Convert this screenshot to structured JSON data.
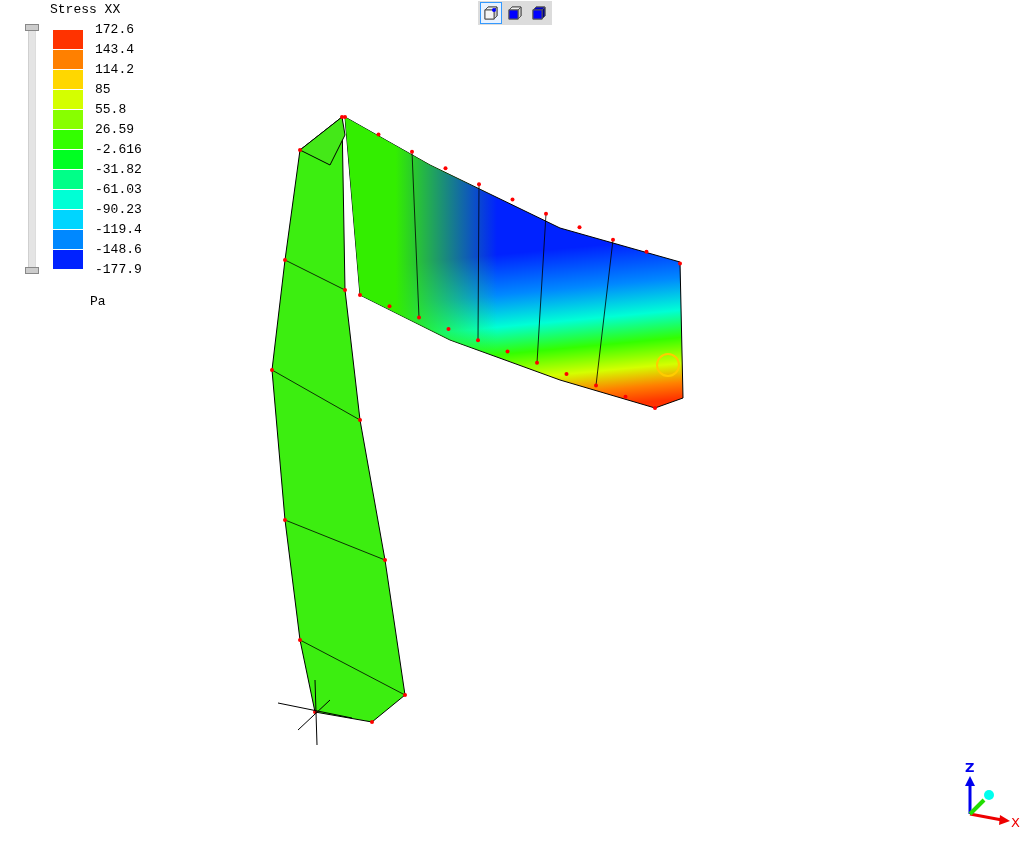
{
  "legend": {
    "title": "Stress XX",
    "unit": "Pa",
    "bands": [
      {
        "color": "#ff3300"
      },
      {
        "color": "#ff8000"
      },
      {
        "color": "#ffd700"
      },
      {
        "color": "#d4ff00"
      },
      {
        "color": "#88ff00"
      },
      {
        "color": "#33ff00"
      },
      {
        "color": "#00ff22"
      },
      {
        "color": "#00ff88"
      },
      {
        "color": "#00ffd5"
      },
      {
        "color": "#00d5ff"
      },
      {
        "color": "#0088ff"
      },
      {
        "color": "#0022ff"
      }
    ],
    "ticks": [
      "172.6",
      "143.4",
      "114.2",
      "85",
      "55.8",
      "26.59",
      "-2.616",
      "-31.82",
      "-61.03",
      "-90.23",
      "-119.4",
      "-148.6",
      "-177.9"
    ]
  },
  "range_slider": {
    "level": 1
  },
  "view_buttons": [
    {
      "kind": "wireframe",
      "selected": true
    },
    {
      "kind": "shaded",
      "selected": false
    },
    {
      "kind": "solid",
      "selected": false
    }
  ],
  "axis_triad": {
    "z_label": "Z",
    "x_label": "X"
  }
}
